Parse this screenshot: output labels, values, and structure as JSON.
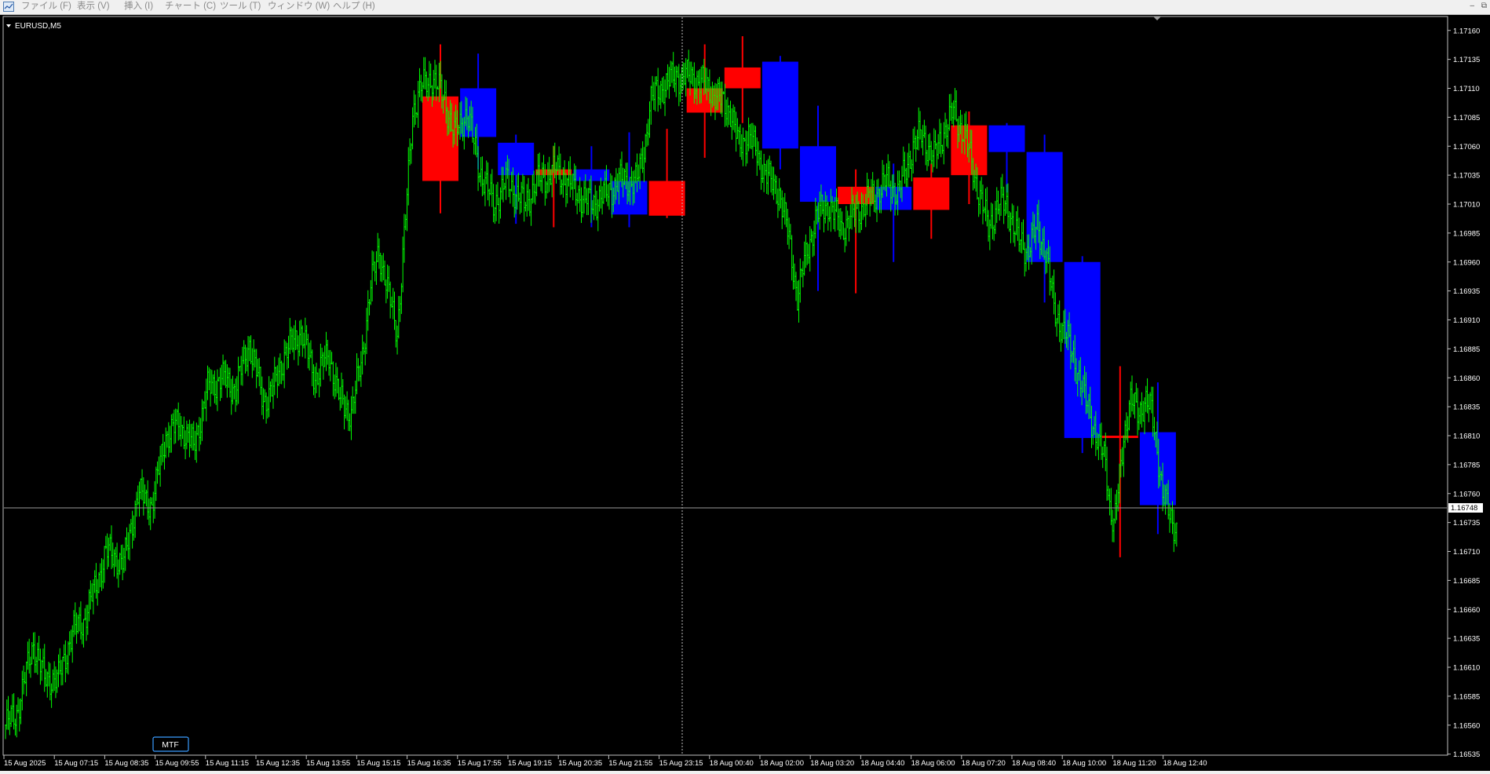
{
  "menu": {
    "items": [
      "ファイル (F)",
      "表示 (V)",
      "挿入 (I)",
      "チャート (C)",
      "ツール (T)",
      "ウィンドウ (W)",
      "ヘルプ (H)"
    ],
    "window_buttons": [
      "–",
      "⧉"
    ]
  },
  "chart": {
    "symbol_label": "EURUSD,M5",
    "mtf_label": "MTF",
    "current_price_label": "1.16748",
    "colors": {
      "background": "#000000",
      "candle": "#00ff00",
      "htf_bull": "#0000ff",
      "htf_bear": "#ff0000",
      "axis_text": "#ffffff",
      "crosshair": "#c0c0c0",
      "mtf_border": "#3a9cff"
    }
  },
  "chart_data": {
    "type": "candlestick",
    "symbol": "EURUSD",
    "timeframe": "M5",
    "overlay": "higher-timeframe candles (blue = down, red = up)",
    "y_ticks": [
      "1.17160",
      "1.17135",
      "1.17110",
      "1.17085",
      "1.17060",
      "1.17035",
      "1.17010",
      "1.16985",
      "1.16960",
      "1.16935",
      "1.16910",
      "1.16885",
      "1.16860",
      "1.16835",
      "1.16810",
      "1.16785",
      "1.16760",
      "1.16735",
      "1.16710",
      "1.16685",
      "1.16660",
      "1.16635",
      "1.16610",
      "1.16585",
      "1.16560",
      "1.16535"
    ],
    "ylim": [
      1.1653,
      1.1717
    ],
    "current_price": 1.16748,
    "x_ticks": [
      "15 Aug 2025",
      "15 Aug 07:15",
      "15 Aug 08:35",
      "15 Aug 09:55",
      "15 Aug 11:15",
      "15 Aug 12:35",
      "15 Aug 13:55",
      "15 Aug 15:15",
      "15 Aug 16:35",
      "15 Aug 17:55",
      "15 Aug 19:15",
      "15 Aug 20:35",
      "15 Aug 21:55",
      "15 Aug 23:15",
      "18 Aug 00:40",
      "18 Aug 02:00",
      "18 Aug 03:20",
      "18 Aug 04:40",
      "18 Aug 06:00",
      "18 Aug 07:20",
      "18 Aug 08:40",
      "18 Aug 10:00",
      "18 Aug 11:20",
      "18 Aug 12:40"
    ],
    "price_path": [
      [
        0,
        1.1656
      ],
      [
        8,
        1.1657
      ],
      [
        20,
        1.1663
      ],
      [
        28,
        1.166
      ],
      [
        38,
        1.166
      ],
      [
        48,
        1.1664
      ],
      [
        56,
        1.1665
      ],
      [
        65,
        1.1668
      ],
      [
        72,
        1.1671
      ],
      [
        85,
        1.167
      ],
      [
        95,
        1.1676
      ],
      [
        105,
        1.1675
      ],
      [
        115,
        1.1681
      ],
      [
        125,
        1.1682
      ],
      [
        135,
        1.168
      ],
      [
        145,
        1.1685
      ],
      [
        155,
        1.1686
      ],
      [
        165,
        1.1685
      ],
      [
        175,
        1.1689
      ],
      [
        185,
        1.1684
      ],
      [
        192,
        1.1685
      ],
      [
        200,
        1.1688
      ],
      [
        212,
        1.169
      ],
      [
        222,
        1.1686
      ],
      [
        232,
        1.1688
      ],
      [
        240,
        1.1684
      ],
      [
        248,
        1.1683
      ],
      [
        256,
        1.1688
      ],
      [
        262,
        1.1694
      ],
      [
        268,
        1.1697
      ],
      [
        275,
        1.1693
      ],
      [
        281,
        1.169
      ],
      [
        286,
        1.1698
      ],
      [
        292,
        1.1709
      ],
      [
        298,
        1.1711
      ],
      [
        306,
        1.1712
      ],
      [
        315,
        1.171
      ],
      [
        322,
        1.1707
      ],
      [
        331,
        1.1709
      ],
      [
        340,
        1.1704
      ],
      [
        350,
        1.1701
      ],
      [
        360,
        1.1703
      ],
      [
        372,
        1.1701
      ],
      [
        382,
        1.1703
      ],
      [
        395,
        1.1704
      ],
      [
        410,
        1.1702
      ],
      [
        420,
        1.1701
      ],
      [
        432,
        1.1702
      ],
      [
        440,
        1.1703
      ],
      [
        447,
        1.1703
      ],
      [
        453,
        1.1703
      ],
      [
        457,
        1.1705
      ],
      [
        463,
        1.171
      ],
      [
        470,
        1.1711
      ],
      [
        480,
        1.1712
      ],
      [
        492,
        1.1712
      ],
      [
        505,
        1.1711
      ],
      [
        512,
        1.171
      ],
      [
        520,
        1.1709
      ],
      [
        526,
        1.1706
      ],
      [
        533,
        1.1707
      ],
      [
        540,
        1.1705
      ],
      [
        548,
        1.1703
      ],
      [
        555,
        1.1702
      ],
      [
        562,
        1.1698
      ],
      [
        568,
        1.1693
      ],
      [
        575,
        1.1697
      ],
      [
        582,
        1.17
      ],
      [
        590,
        1.1701
      ],
      [
        600,
        1.1699
      ],
      [
        608,
        1.17
      ],
      [
        616,
        1.1701
      ],
      [
        625,
        1.1702
      ],
      [
        632,
        1.1703
      ],
      [
        640,
        1.1702
      ],
      [
        646,
        1.1704
      ],
      [
        651,
        1.1706
      ],
      [
        657,
        1.1707
      ],
      [
        666,
        1.1705
      ],
      [
        672,
        1.1707
      ],
      [
        680,
        1.1709
      ],
      [
        688,
        1.1707
      ],
      [
        696,
        1.1703
      ],
      [
        705,
        1.1699
      ],
      [
        712,
        1.1701
      ],
      [
        718,
        1.1701
      ],
      [
        726,
        1.1698
      ],
      [
        733,
        1.1697
      ],
      [
        740,
        1.1699
      ],
      [
        746,
        1.1697
      ],
      [
        752,
        1.1692
      ],
      [
        759,
        1.169
      ],
      [
        766,
        1.1688
      ],
      [
        772,
        1.1685
      ],
      [
        778,
        1.1683
      ],
      [
        784,
        1.168
      ],
      [
        789,
        1.1679
      ],
      [
        792,
        1.1675
      ],
      [
        795,
        1.1673
      ],
      [
        798,
        1.1676
      ],
      [
        802,
        1.1681
      ],
      [
        807,
        1.1684
      ],
      [
        812,
        1.1683
      ],
      [
        818,
        1.1684
      ],
      [
        822,
        1.1683
      ],
      [
        826,
        1.168
      ],
      [
        830,
        1.1676
      ],
      [
        835,
        1.1674
      ],
      [
        840,
        1.1673
      ]
    ],
    "htf_candles": [
      {
        "index": 0,
        "open": 1.17103,
        "close": 1.1703,
        "high": 1.17148,
        "low": 1.17002,
        "dir": "up"
      },
      {
        "index": 1,
        "open": 1.1711,
        "close": 1.17068,
        "high": 1.1714,
        "low": 1.1704,
        "dir": "down"
      },
      {
        "index": 2,
        "open": 1.17063,
        "close": 1.17035,
        "high": 1.1707,
        "low": 1.16993,
        "dir": "down"
      },
      {
        "index": 3,
        "open": 1.1704,
        "close": 1.17035,
        "high": 1.1706,
        "low": 1.1699,
        "dir": "up"
      },
      {
        "index": 4,
        "open": 1.1704,
        "close": 1.1703,
        "high": 1.1706,
        "low": 1.1699,
        "dir": "down"
      },
      {
        "index": 5,
        "open": 1.1703,
        "close": 1.17001,
        "high": 1.17072,
        "low": 1.1699,
        "dir": "down"
      },
      {
        "index": 6,
        "open": 1.17,
        "close": 1.1703,
        "high": 1.17075,
        "low": 1.16998,
        "dir": "up"
      },
      {
        "index": 7,
        "open": 1.17089,
        "close": 1.1711,
        "high": 1.17148,
        "low": 1.1705,
        "dir": "up"
      },
      {
        "index": 8,
        "open": 1.1711,
        "close": 1.17128,
        "high": 1.17155,
        "low": 1.1708,
        "dir": "up"
      },
      {
        "index": 9,
        "open": 1.17133,
        "close": 1.17058,
        "high": 1.17138,
        "low": 1.1704,
        "dir": "down"
      },
      {
        "index": 10,
        "open": 1.1706,
        "close": 1.17012,
        "high": 1.17095,
        "low": 1.16935,
        "dir": "down"
      },
      {
        "index": 11,
        "open": 1.1701,
        "close": 1.17025,
        "high": 1.1704,
        "low": 1.16933,
        "dir": "up"
      },
      {
        "index": 12,
        "open": 1.17025,
        "close": 1.17005,
        "high": 1.17045,
        "low": 1.1696,
        "dir": "down"
      },
      {
        "index": 13,
        "open": 1.17005,
        "close": 1.17033,
        "high": 1.17045,
        "low": 1.1698,
        "dir": "up"
      },
      {
        "index": 14,
        "open": 1.17035,
        "close": 1.17078,
        "high": 1.1709,
        "low": 1.1701,
        "dir": "up"
      },
      {
        "index": 15,
        "open": 1.17078,
        "close": 1.17055,
        "high": 1.1708,
        "low": 1.1702,
        "dir": "down"
      },
      {
        "index": 16,
        "open": 1.17055,
        "close": 1.1696,
        "high": 1.1707,
        "low": 1.16925,
        "dir": "down"
      },
      {
        "index": 17,
        "open": 1.1696,
        "close": 1.16808,
        "high": 1.16965,
        "low": 1.16795,
        "dir": "down"
      },
      {
        "index": 18,
        "open": 1.16808,
        "close": 1.1681,
        "high": 1.1687,
        "low": 1.16705,
        "dir": "up"
      },
      {
        "index": 19,
        "open": 1.16813,
        "close": 1.1675,
        "high": 1.16856,
        "low": 1.16725,
        "dir": "down"
      }
    ]
  }
}
